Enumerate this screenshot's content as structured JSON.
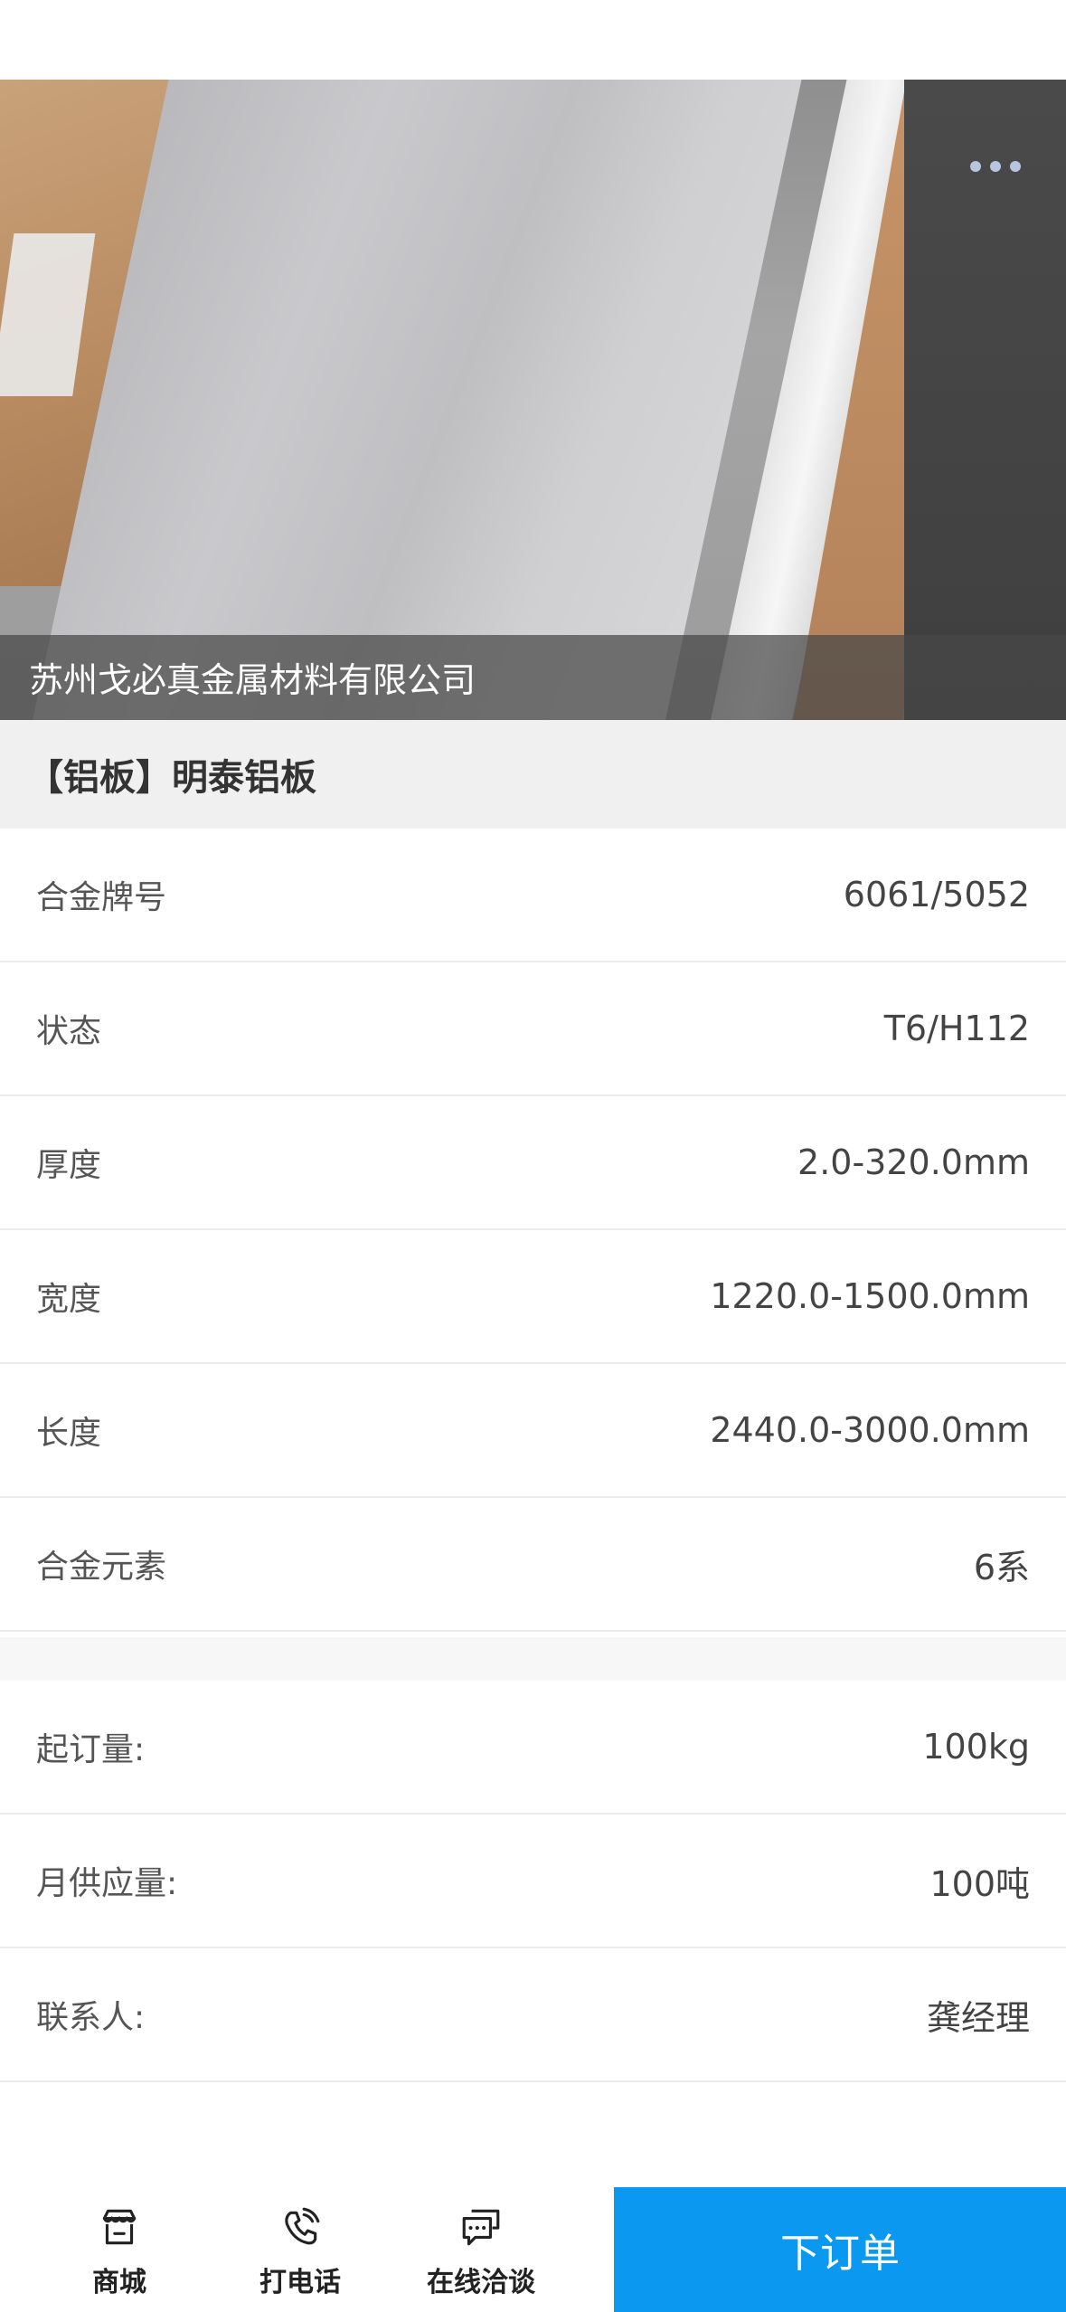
{
  "hero": {
    "company_name": "苏州戈必真金属材料有限公司",
    "more_icon": "more-dots-icon"
  },
  "product": {
    "title": "【铝板】明泰铝板"
  },
  "specs": [
    {
      "label": "合金牌号",
      "value": "6061/5052"
    },
    {
      "label": "状态",
      "value": "T6/H112"
    },
    {
      "label": "厚度",
      "value": "2.0-320.0mm"
    },
    {
      "label": "宽度",
      "value": "1220.0-1500.0mm"
    },
    {
      "label": "长度",
      "value": "2440.0-3000.0mm"
    },
    {
      "label": "合金元素",
      "value": "6系"
    }
  ],
  "order_info": [
    {
      "label": "起订量:",
      "value": "100kg"
    },
    {
      "label": "月供应量:",
      "value": "100吨"
    },
    {
      "label": "联系人:",
      "value": "龚经理"
    }
  ],
  "bottom_nav": {
    "shop": {
      "label": "商城",
      "icon": "store-icon"
    },
    "call": {
      "label": "打电话",
      "icon": "phone-icon"
    },
    "chat": {
      "label": "在线洽谈",
      "icon": "chat-icon"
    },
    "order_button": "下订单"
  },
  "colors": {
    "accent": "#0a98f0",
    "title_band": "#f0f0f0"
  }
}
